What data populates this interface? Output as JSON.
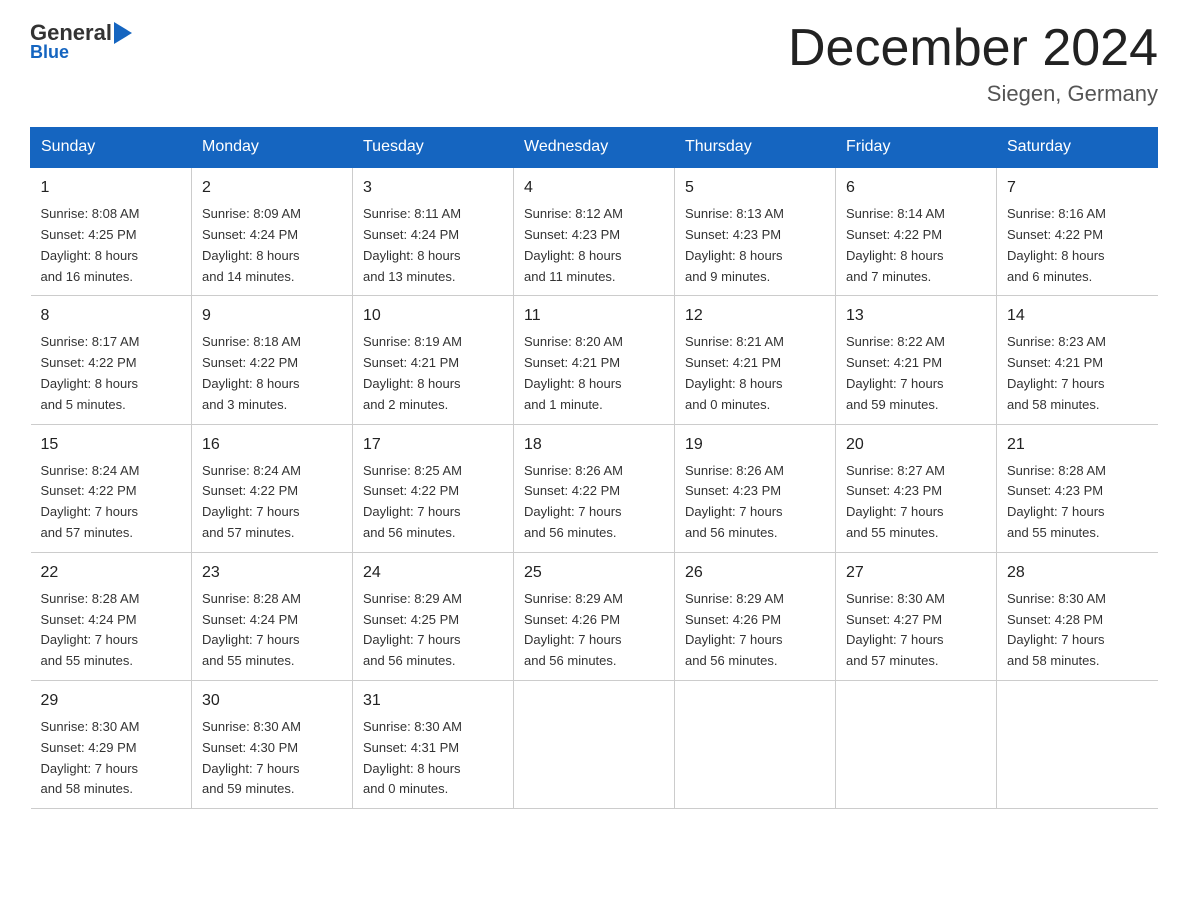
{
  "header": {
    "logo_general": "General",
    "logo_blue": "Blue",
    "main_title": "December 2024",
    "subtitle": "Siegen, Germany"
  },
  "days_of_week": [
    "Sunday",
    "Monday",
    "Tuesday",
    "Wednesday",
    "Thursday",
    "Friday",
    "Saturday"
  ],
  "weeks": [
    [
      {
        "day": "1",
        "info": "Sunrise: 8:08 AM\nSunset: 4:25 PM\nDaylight: 8 hours\nand 16 minutes."
      },
      {
        "day": "2",
        "info": "Sunrise: 8:09 AM\nSunset: 4:24 PM\nDaylight: 8 hours\nand 14 minutes."
      },
      {
        "day": "3",
        "info": "Sunrise: 8:11 AM\nSunset: 4:24 PM\nDaylight: 8 hours\nand 13 minutes."
      },
      {
        "day": "4",
        "info": "Sunrise: 8:12 AM\nSunset: 4:23 PM\nDaylight: 8 hours\nand 11 minutes."
      },
      {
        "day": "5",
        "info": "Sunrise: 8:13 AM\nSunset: 4:23 PM\nDaylight: 8 hours\nand 9 minutes."
      },
      {
        "day": "6",
        "info": "Sunrise: 8:14 AM\nSunset: 4:22 PM\nDaylight: 8 hours\nand 7 minutes."
      },
      {
        "day": "7",
        "info": "Sunrise: 8:16 AM\nSunset: 4:22 PM\nDaylight: 8 hours\nand 6 minutes."
      }
    ],
    [
      {
        "day": "8",
        "info": "Sunrise: 8:17 AM\nSunset: 4:22 PM\nDaylight: 8 hours\nand 5 minutes."
      },
      {
        "day": "9",
        "info": "Sunrise: 8:18 AM\nSunset: 4:22 PM\nDaylight: 8 hours\nand 3 minutes."
      },
      {
        "day": "10",
        "info": "Sunrise: 8:19 AM\nSunset: 4:21 PM\nDaylight: 8 hours\nand 2 minutes."
      },
      {
        "day": "11",
        "info": "Sunrise: 8:20 AM\nSunset: 4:21 PM\nDaylight: 8 hours\nand 1 minute."
      },
      {
        "day": "12",
        "info": "Sunrise: 8:21 AM\nSunset: 4:21 PM\nDaylight: 8 hours\nand 0 minutes."
      },
      {
        "day": "13",
        "info": "Sunrise: 8:22 AM\nSunset: 4:21 PM\nDaylight: 7 hours\nand 59 minutes."
      },
      {
        "day": "14",
        "info": "Sunrise: 8:23 AM\nSunset: 4:21 PM\nDaylight: 7 hours\nand 58 minutes."
      }
    ],
    [
      {
        "day": "15",
        "info": "Sunrise: 8:24 AM\nSunset: 4:22 PM\nDaylight: 7 hours\nand 57 minutes."
      },
      {
        "day": "16",
        "info": "Sunrise: 8:24 AM\nSunset: 4:22 PM\nDaylight: 7 hours\nand 57 minutes."
      },
      {
        "day": "17",
        "info": "Sunrise: 8:25 AM\nSunset: 4:22 PM\nDaylight: 7 hours\nand 56 minutes."
      },
      {
        "day": "18",
        "info": "Sunrise: 8:26 AM\nSunset: 4:22 PM\nDaylight: 7 hours\nand 56 minutes."
      },
      {
        "day": "19",
        "info": "Sunrise: 8:26 AM\nSunset: 4:23 PM\nDaylight: 7 hours\nand 56 minutes."
      },
      {
        "day": "20",
        "info": "Sunrise: 8:27 AM\nSunset: 4:23 PM\nDaylight: 7 hours\nand 55 minutes."
      },
      {
        "day": "21",
        "info": "Sunrise: 8:28 AM\nSunset: 4:23 PM\nDaylight: 7 hours\nand 55 minutes."
      }
    ],
    [
      {
        "day": "22",
        "info": "Sunrise: 8:28 AM\nSunset: 4:24 PM\nDaylight: 7 hours\nand 55 minutes."
      },
      {
        "day": "23",
        "info": "Sunrise: 8:28 AM\nSunset: 4:24 PM\nDaylight: 7 hours\nand 55 minutes."
      },
      {
        "day": "24",
        "info": "Sunrise: 8:29 AM\nSunset: 4:25 PM\nDaylight: 7 hours\nand 56 minutes."
      },
      {
        "day": "25",
        "info": "Sunrise: 8:29 AM\nSunset: 4:26 PM\nDaylight: 7 hours\nand 56 minutes."
      },
      {
        "day": "26",
        "info": "Sunrise: 8:29 AM\nSunset: 4:26 PM\nDaylight: 7 hours\nand 56 minutes."
      },
      {
        "day": "27",
        "info": "Sunrise: 8:30 AM\nSunset: 4:27 PM\nDaylight: 7 hours\nand 57 minutes."
      },
      {
        "day": "28",
        "info": "Sunrise: 8:30 AM\nSunset: 4:28 PM\nDaylight: 7 hours\nand 58 minutes."
      }
    ],
    [
      {
        "day": "29",
        "info": "Sunrise: 8:30 AM\nSunset: 4:29 PM\nDaylight: 7 hours\nand 58 minutes."
      },
      {
        "day": "30",
        "info": "Sunrise: 8:30 AM\nSunset: 4:30 PM\nDaylight: 7 hours\nand 59 minutes."
      },
      {
        "day": "31",
        "info": "Sunrise: 8:30 AM\nSunset: 4:31 PM\nDaylight: 8 hours\nand 0 minutes."
      },
      {
        "day": "",
        "info": ""
      },
      {
        "day": "",
        "info": ""
      },
      {
        "day": "",
        "info": ""
      },
      {
        "day": "",
        "info": ""
      }
    ]
  ]
}
